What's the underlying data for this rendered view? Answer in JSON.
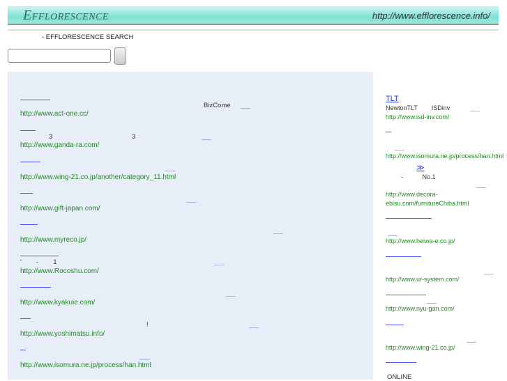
{
  "header": {
    "logo": "Efflorescence",
    "url": "http://www.efflorescence.info/"
  },
  "search": {
    "label": "- EFFLORESCENCE SEARCH",
    "placeholder": ""
  },
  "main": {
    "entries": [
      {
        "desc": "BizCome",
        "url": "http://www.act-one.cc/"
      },
      {
        "desc_a": "3",
        "desc_b": "3",
        "url": "http://www.ganda-ra.com/"
      },
      {
        "url": "http://www.wing-21.co.jp/another/category_11.html"
      },
      {
        "url": "http://www.gift-japan.com/"
      },
      {
        "url": "http://www.myreco.jp/"
      },
      {
        "desc": "'        -        1",
        "url": "http://www.Rocoshu.com/"
      },
      {
        "url": "http://www.kyakuie.com/"
      },
      {
        "desc": "!",
        "url": "http://www.yoshimatsu.info/"
      },
      {
        "url": "http://www.isomura.ne.jp/process/han.html"
      }
    ]
  },
  "sidebar": {
    "entries": [
      {
        "title": "TLT",
        "desc": "NewtonTLT        ISDinv",
        "url": "http://www.isd-inv.com/"
      },
      {
        "url": "http://www.isomura.ne.jp/process/han.html"
      },
      {
        "title": "≫",
        "desc": "-           No.1",
        "url": "http://www.decora-ebisu.com/furnitureChiba.html"
      },
      {
        "url": "http://www.heiwa-e.co.jp/"
      },
      {
        "url": "http://www.ur-system.com/"
      },
      {
        "url": "http://www.nyu-gan.com/"
      },
      {
        "url": "http://www.wing-21.co.jp/"
      }
    ],
    "online": "ONLINE"
  }
}
